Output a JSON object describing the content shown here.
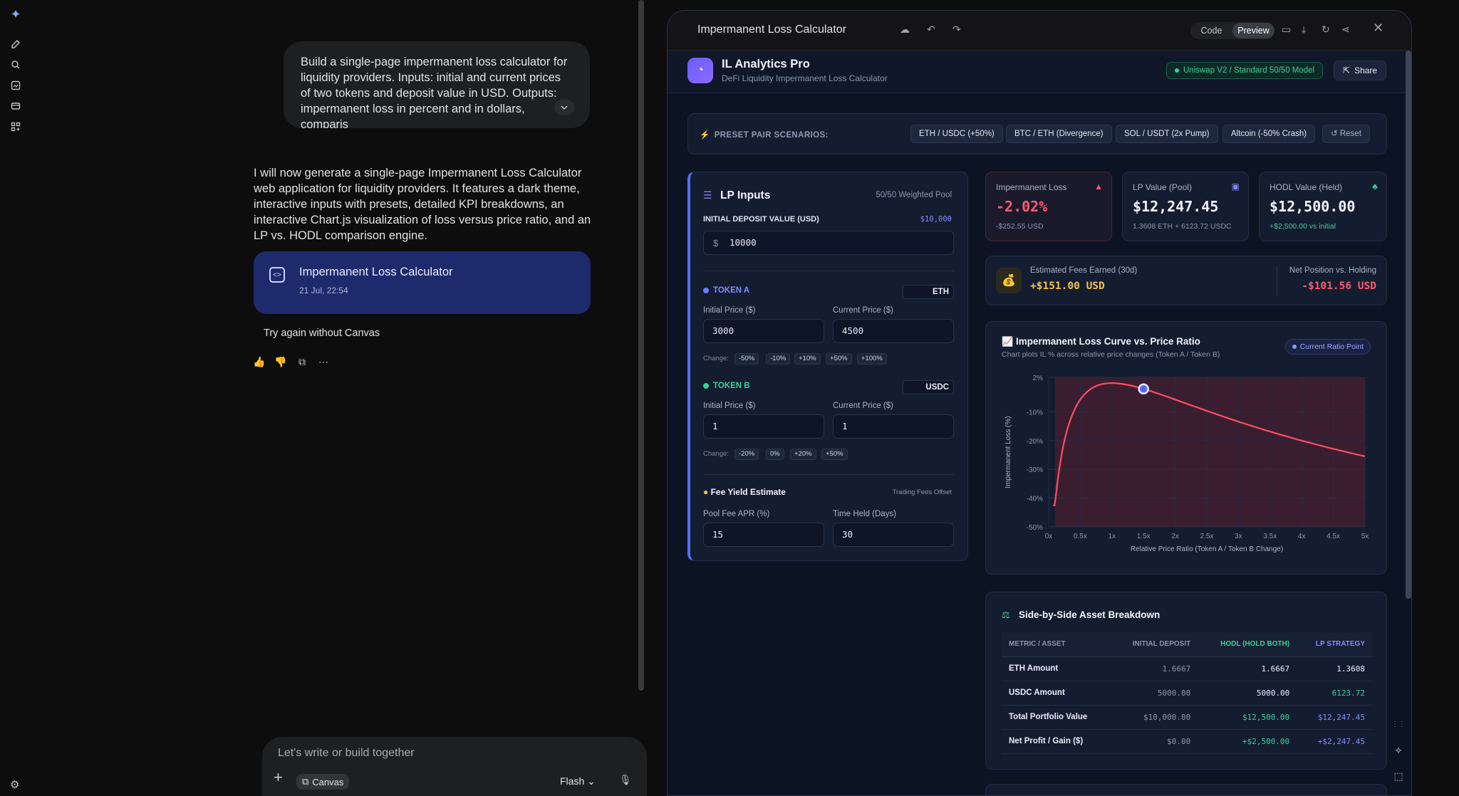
{
  "rail": {
    "icons": [
      "gemini-spark-icon",
      "new-chat-icon",
      "search-icon",
      "my-stuff-icon",
      "gems-icon",
      "apps-icon"
    ],
    "settings_icon": "gear-icon"
  },
  "chat": {
    "user_message": "Build a single-page impermanent loss calculator for liquidity providers. Inputs: initial and current prices of two tokens and deposit value in USD. Outputs: impermanent loss in percent and in dollars, comparis",
    "ai_message": "I will now generate a single-page Impermanent Loss Calculator web application for liquidity providers. It features a dark theme, interactive inputs with presets, detailed KPI breakdowns, an interactive Chart.js visualization of loss versus price ratio, and an LP vs. HODL comparison engine.",
    "canvas_card": {
      "title": "Impermanent Loss Calculator",
      "date": "21 Jul, 22:54"
    },
    "try_again": "Try again without Canvas",
    "composer": {
      "placeholder": "Let's write or build together",
      "canvas_chip": "Canvas",
      "model": "Flash"
    }
  },
  "canvas": {
    "title": "Impermanent Loss Calculator",
    "toggle": {
      "code": "Code",
      "preview": "Preview"
    }
  },
  "app": {
    "brand": "IL Analytics Pro",
    "brand_sub": "DeFi Liquidity Impermanent Loss Calculator",
    "model_badge": "Uniswap V2 / Standard 50/50 Model",
    "share": "Share",
    "presets": {
      "label": "PRESET PAIR SCENARIOS:",
      "items": [
        "ETH / USDC (+50%)",
        "BTC / ETH (Divergence)",
        "SOL / USDT (2x Pump)",
        "Altcoin (-50% Crash)"
      ],
      "reset": "Reset"
    },
    "inputs": {
      "title": "LP Inputs",
      "pool": "50/50 Weighted Pool",
      "deposit_label": "INITIAL DEPOSIT VALUE (USD)",
      "deposit_display": "$10,000",
      "currency": "$",
      "deposit_value": "10000",
      "token_a": {
        "label": "TOKEN A",
        "symbol": "ETH",
        "initial_label": "Initial Price ($)",
        "current_label": "Current Price ($)",
        "initial": "3000",
        "current": "4500",
        "change_label": "Change:",
        "chips": [
          "-50%",
          "-10%",
          "+10%",
          "+50%",
          "+100%"
        ],
        "color": "#6b7cff"
      },
      "token_b": {
        "label": "TOKEN B",
        "symbol": "USDC",
        "initial_label": "Initial Price ($)",
        "current_label": "Current Price ($)",
        "initial": "1",
        "current": "1",
        "change_label": "Change:",
        "chips": [
          "-20%",
          "0%",
          "+20%",
          "+50%"
        ],
        "color": "#3ccf96"
      },
      "fee": {
        "title": "Fee Yield Estimate",
        "tag": "Trading Fees Offset",
        "apr_label": "Pool Fee APR (%)",
        "apr": "15",
        "days_label": "Time Held (Days)",
        "days": "30"
      }
    },
    "kpis": [
      {
        "title": "Impermanent Loss",
        "value": "-2.02%",
        "sub": "-$252.55 USD",
        "color": "#ff5a6e"
      },
      {
        "title": "LP Value (Pool)",
        "value": "$12,247.45",
        "sub": "1.3608 ETH + 6123.72 USDC",
        "color": "#f1f4fb"
      },
      {
        "title": "HODL Value (Held)",
        "value": "$12,500.00",
        "sub": "+$2,500.00 vs initial",
        "color": "#f1f4fb"
      }
    ],
    "fees": {
      "title": "Estimated Fees Earned (30d)",
      "value": "+$151.00 USD",
      "net_title": "Net Position vs. Holding",
      "net_value": "-$101.56 USD"
    },
    "breakdown": {
      "title": "Side-by-Side Asset Breakdown",
      "headers": [
        "METRIC / ASSET",
        "INITIAL DEPOSIT",
        "HODL (HOLD BOTH)",
        "LP STRATEGY"
      ],
      "rows": [
        [
          "ETH Amount",
          "1.6667",
          "1.6667",
          "1.3608"
        ],
        [
          "USDC Amount",
          "5000.00",
          "5000.00",
          "6123.72"
        ],
        [
          "Total Portfolio Value",
          "$10,000.00",
          "$12,500.00",
          "$12,247.45"
        ],
        [
          "Net Profit / Gain ($)",
          "$0.00",
          "+$2,500.00",
          "+$2,247.45"
        ]
      ]
    }
  },
  "chart_data": {
    "type": "line",
    "title": "Impermanent Loss Curve vs. Price Ratio",
    "subtitle": "Chart plots IL % across relative price changes (Token A / Token B)",
    "legend": [
      "Current Ratio Point"
    ],
    "xlabel": "Relative Price Ratio (Token A / Token B Change)",
    "ylabel": "Impermanent Loss (%)",
    "xlim": [
      0,
      5
    ],
    "ylim": [
      -50,
      2
    ],
    "x_ticks": [
      "0x",
      "0.5x",
      "1x",
      "1.5x",
      "2x",
      "2.5x",
      "3x",
      "3.5x",
      "4x",
      "4.5x",
      "5x"
    ],
    "y_ticks": [
      "2%",
      "-10%",
      "-20%",
      "-30%",
      "-40%",
      "-50%"
    ],
    "series": [
      {
        "x": [
          0.05,
          0.1,
          0.15,
          0.2,
          0.3,
          0.4,
          0.5,
          0.6,
          0.7,
          0.8,
          0.9,
          1,
          1.25,
          1.5,
          1.75,
          2,
          2.5,
          3,
          3.5,
          4,
          4.5,
          5
        ],
        "y": [
          -42.6,
          -42.5,
          -32.6,
          -25.5,
          -15.7,
          -9.6,
          -5.7,
          -3.2,
          -1.6,
          -0.6,
          -0.1,
          0,
          -0.6,
          -2.0,
          -3.8,
          -5.7,
          -9.6,
          -13.4,
          -16.8,
          -20,
          -22.9,
          -25.5
        ]
      }
    ],
    "current_point": {
      "x": 1.5,
      "y": -2.02
    },
    "colors": {
      "line": "#ff4d63",
      "fill": "#5a1f30",
      "point": "#4f6cf7"
    },
    "grid": true
  }
}
